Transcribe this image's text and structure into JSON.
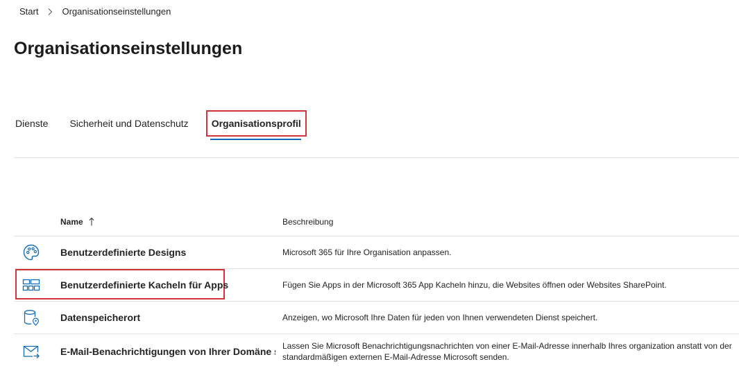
{
  "breadcrumb": {
    "home": "Start",
    "current": "Organisationseinstellungen"
  },
  "page_title": "Organisationseinstellungen",
  "tabs": [
    {
      "label": "Dienste",
      "active": false
    },
    {
      "label": "Sicherheit und Datenschutz",
      "active": false
    },
    {
      "label": "Organisationsprofil",
      "active": true
    }
  ],
  "table": {
    "headers": {
      "name": "Name",
      "description": "Beschreibung"
    },
    "sort": "ascending",
    "rows": [
      {
        "icon": "palette-icon",
        "name": "Benutzerdefinierte Designs",
        "description": "Microsoft 365 für Ihre Organisation anpassen."
      },
      {
        "icon": "app-tiles-icon",
        "name": "Benutzerdefinierte Kacheln für Apps",
        "description": "Fügen Sie Apps in der Microsoft 365 App Kacheln hinzu, die Websites öffnen oder Websites SharePoint."
      },
      {
        "icon": "database-location-icon",
        "name": "Datenspeicherort",
        "description": "Anzeigen, wo Microsoft Ihre Daten für jeden von Ihnen verwendeten Dienst speichert."
      },
      {
        "icon": "mail-send-icon",
        "name": "E-Mail-Benachrichtigungen von Ihrer Domäne senden",
        "description": "Lassen Sie Microsoft Benachrichtigungsnachrichten von einer E-Mail-Adresse innerhalb Ihres organization anstatt von der standardmäßigen externen E-Mail-Adresse Microsoft senden."
      }
    ]
  },
  "colors": {
    "accent": "#0f6cbd",
    "highlight": "#d13438",
    "divider": "#e1e1e1",
    "text": "#242424"
  }
}
